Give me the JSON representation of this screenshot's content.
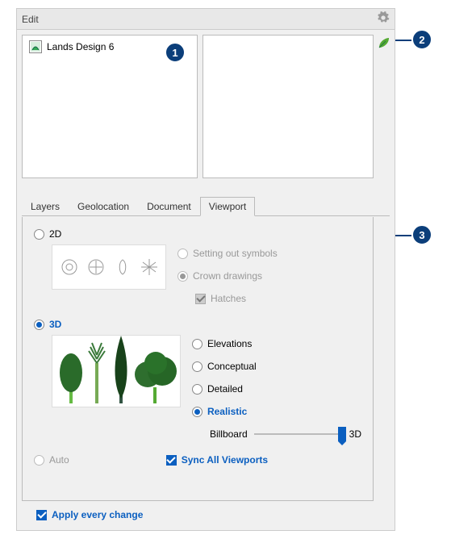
{
  "header": {
    "menu_edit": "Edit"
  },
  "tree": {
    "items": [
      {
        "label": "Lands Design 6"
      }
    ]
  },
  "tabs": {
    "layers": "Layers",
    "geolocation": "Geolocation",
    "document": "Document",
    "viewport": "Viewport",
    "active": "viewport"
  },
  "viewport": {
    "mode_2d": "2D",
    "mode_3d": "3D",
    "mode_auto": "Auto",
    "sub2d": {
      "setting_out": "Setting out symbols",
      "crown": "Crown drawings",
      "hatches": "Hatches"
    },
    "sub3d": {
      "elevations": "Elevations",
      "conceptual": "Conceptual",
      "detailed": "Detailed",
      "realistic": "Realistic",
      "billboard": "Billboard",
      "slider_end": "3D"
    },
    "sync_all": "Sync All Viewports"
  },
  "footer": {
    "apply_every_change": "Apply every change"
  },
  "callouts": {
    "c1": "1",
    "c2": "2",
    "c3": "3"
  },
  "icons": {
    "gear": "gear-icon",
    "lands_item": "lands-item-icon",
    "leaf": "leaf-icon"
  }
}
